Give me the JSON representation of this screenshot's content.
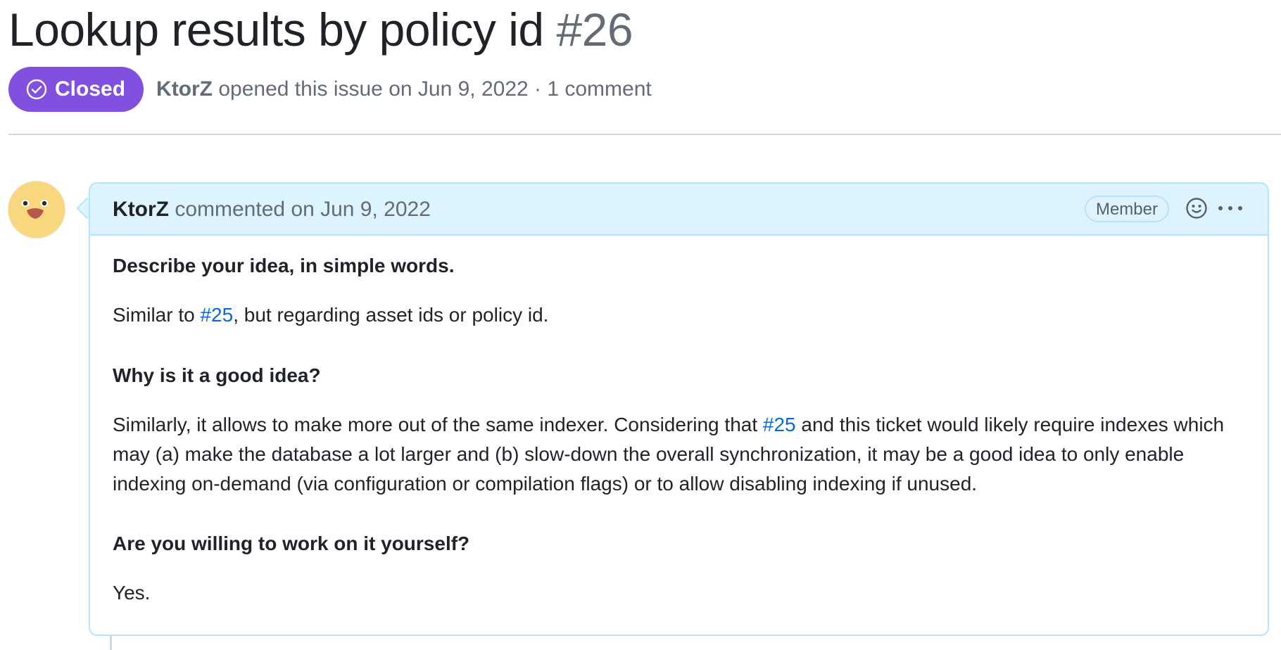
{
  "issue": {
    "title": "Lookup results by policy id",
    "number": "#26",
    "state": "Closed",
    "author": "KtorZ",
    "opened_text": "opened this issue on Jun 9, 2022 · 1 comment"
  },
  "comment": {
    "author": "KtorZ",
    "commented_text": "commented on Jun 9, 2022",
    "role_badge": "Member",
    "avatar_icon": "duck-avatar-icon",
    "body": {
      "h1": "Describe your idea, in simple words.",
      "p1_before": "Similar to ",
      "p1_link": "#25",
      "p1_after": ", but regarding asset ids or policy id.",
      "h2": "Why is it a good idea?",
      "p2_before": "Similarly, it allows to make more out of the same indexer. Considering that ",
      "p2_link": "#25",
      "p2_after": " and this ticket would likely require indexes which may (a) make the database a lot larger and (b) slow-down the overall synchronization, it may be a good idea to only enable indexing on-demand (via configuration or compilation flags) or to allow disabling indexing if unused.",
      "h3": "Are you willing to work on it yourself?",
      "p3": "Yes."
    }
  },
  "colors": {
    "closed_badge": "#8250df",
    "link": "#0969da",
    "header_bg": "#ddf4ff",
    "header_border": "#b6e3ff"
  }
}
